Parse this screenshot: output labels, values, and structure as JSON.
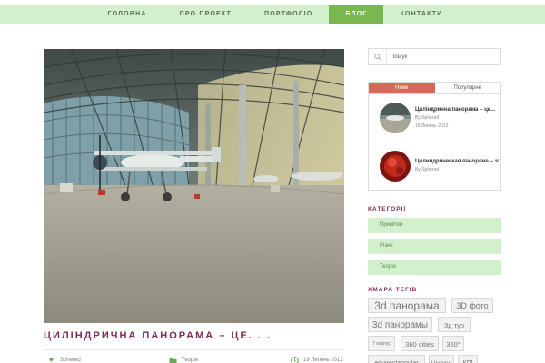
{
  "nav": {
    "items": [
      {
        "label": "ГОЛОВНА",
        "active": false
      },
      {
        "label": "ПРО ПРОЕКТ",
        "active": false
      },
      {
        "label": "ПОРТФОЛІО",
        "active": false
      },
      {
        "label": "БЛОГ",
        "active": true
      },
      {
        "label": "КОНТАКТИ",
        "active": false
      }
    ]
  },
  "post": {
    "title": "ЦИЛІНДРИЧНА ПАНОРАМА – ЦЕ. . .",
    "author": "Sphered",
    "category": "Теорія",
    "date": "19 Липень 2013"
  },
  "search": {
    "placeholder": "Пошук",
    "value": ""
  },
  "tabs": {
    "new_label": "Нове",
    "popular_label": "Популярне",
    "active": "new"
  },
  "recent_posts": [
    {
      "title": "Циліндрична панорама – це...",
      "author": "By Sphered",
      "date": "19 Липень 2013"
    },
    {
      "title": "Цилиндрическая панорама – это...",
      "author": "By Sphered",
      "date": ""
    }
  ],
  "categories": {
    "title": "КАТЕГОРІЇ",
    "items": [
      "Примітки",
      "Різне",
      "Теорія"
    ]
  },
  "tag_cloud": {
    "title": "ХМАРА ТЕГІВ",
    "tags": [
      "3d панорама",
      "3D фото",
      "3d панорамы",
      "3д тур",
      "7 корпус",
      "360 cities",
      "360°",
      "equirectangular",
      "Ukraine",
      "КПІ"
    ]
  },
  "colors": {
    "nav_bg": "#d3f0cd",
    "nav_active": "#79b84f",
    "accent_title": "#7c2d52",
    "tab_active": "#d66a58",
    "category_bg": "#d3f0cd"
  },
  "icons": {
    "search": "search-icon",
    "author": "user-icon",
    "category": "folder-icon",
    "date": "clock-icon"
  }
}
